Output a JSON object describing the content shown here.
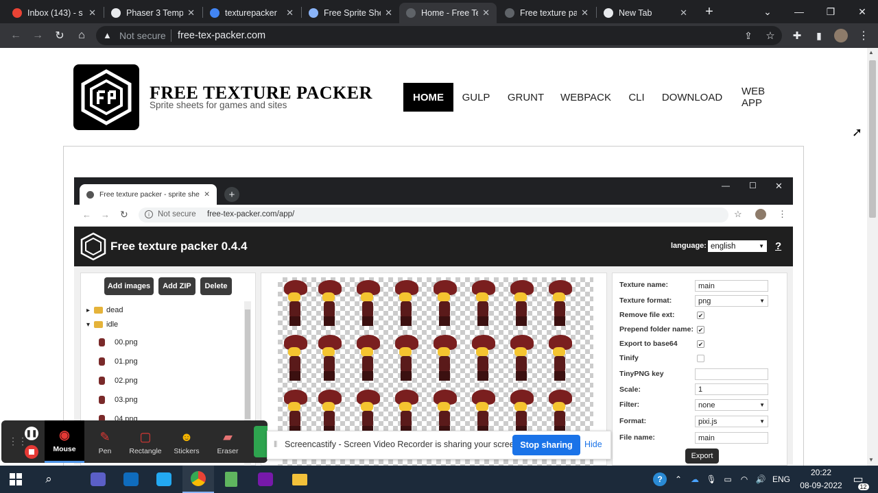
{
  "browser": {
    "tabs": [
      {
        "title": "Inbox (143) - s",
        "favicon": "gmail-icon",
        "color": "#ea4335"
      },
      {
        "title": "Phaser 3 Temp",
        "favicon": "chrome-icon",
        "color": "#e8eaed"
      },
      {
        "title": "texturepacker",
        "favicon": "google-icon",
        "color": "#4285f4"
      },
      {
        "title": "Free Sprite She",
        "favicon": "globe-icon",
        "color": "#8ab4f8"
      },
      {
        "title": "Home - Free Te",
        "favicon": "ftp-icon",
        "color": "#5f6368"
      },
      {
        "title": "Free texture pa",
        "favicon": "ftp-icon",
        "color": "#5f6368"
      },
      {
        "title": "New Tab",
        "favicon": "chrome-icon",
        "color": "#e8eaed"
      }
    ],
    "active_tab_index": 4,
    "new_tab": "+",
    "security": "Not secure",
    "url": "free-tex-packer.com"
  },
  "site": {
    "title": "FREE TEXTURE PACKER",
    "subtitle": "Sprite sheets for games and sites",
    "nav": [
      "HOME",
      "GULP",
      "GRUNT",
      "WEBPACK",
      "CLI",
      "DOWNLOAD",
      "WEB APP"
    ],
    "nav_active": "HOME"
  },
  "video": {
    "tab_title": "Free texture packer - sprite sheet",
    "security": "Not secure",
    "url": "free-tex-packer.com/app/",
    "app_title": "Free texture packer 0.4.4",
    "language_label": "language:",
    "language_value": "english",
    "help": "?",
    "buttons": [
      "Add images",
      "Add ZIP",
      "Delete"
    ],
    "tree": [
      {
        "label": "dead",
        "type": "folder",
        "expanded": false
      },
      {
        "label": "idle",
        "type": "folder",
        "expanded": true
      },
      {
        "label": "00.png",
        "type": "file"
      },
      {
        "label": "01.png",
        "type": "file"
      },
      {
        "label": "02.png",
        "type": "file"
      },
      {
        "label": "03.png",
        "type": "file"
      },
      {
        "label": "04.png",
        "type": "file"
      }
    ],
    "props": {
      "texture_name_label": "Texture name:",
      "texture_name": "main",
      "texture_format_label": "Texture format:",
      "texture_format": "png",
      "remove_ext_label": "Remove file ext:",
      "prepend_label": "Prepend folder name:",
      "base64_label": "Export to base64",
      "tinify_label": "Tinify",
      "tinypng_label": "TinyPNG key",
      "scale_label": "Scale:",
      "scale": "1",
      "filter_label": "Filter:",
      "filter": "none",
      "format_label": "Format:",
      "format": "pixi.js",
      "filename_label": "File name:",
      "filename": "main",
      "export": "Export"
    }
  },
  "screencastify": {
    "tools": [
      "Mouse",
      "Pen",
      "Rectangle",
      "Stickers",
      "Eraser"
    ],
    "active_tool": "Mouse",
    "message": "Screencastify - Screen Video Recorder is sharing your screen.",
    "stop": "Stop sharing",
    "hide": "Hide"
  },
  "taskbar": {
    "language": "ENG",
    "time": "20:22",
    "date": "08-09-2022",
    "notifications": "12"
  }
}
